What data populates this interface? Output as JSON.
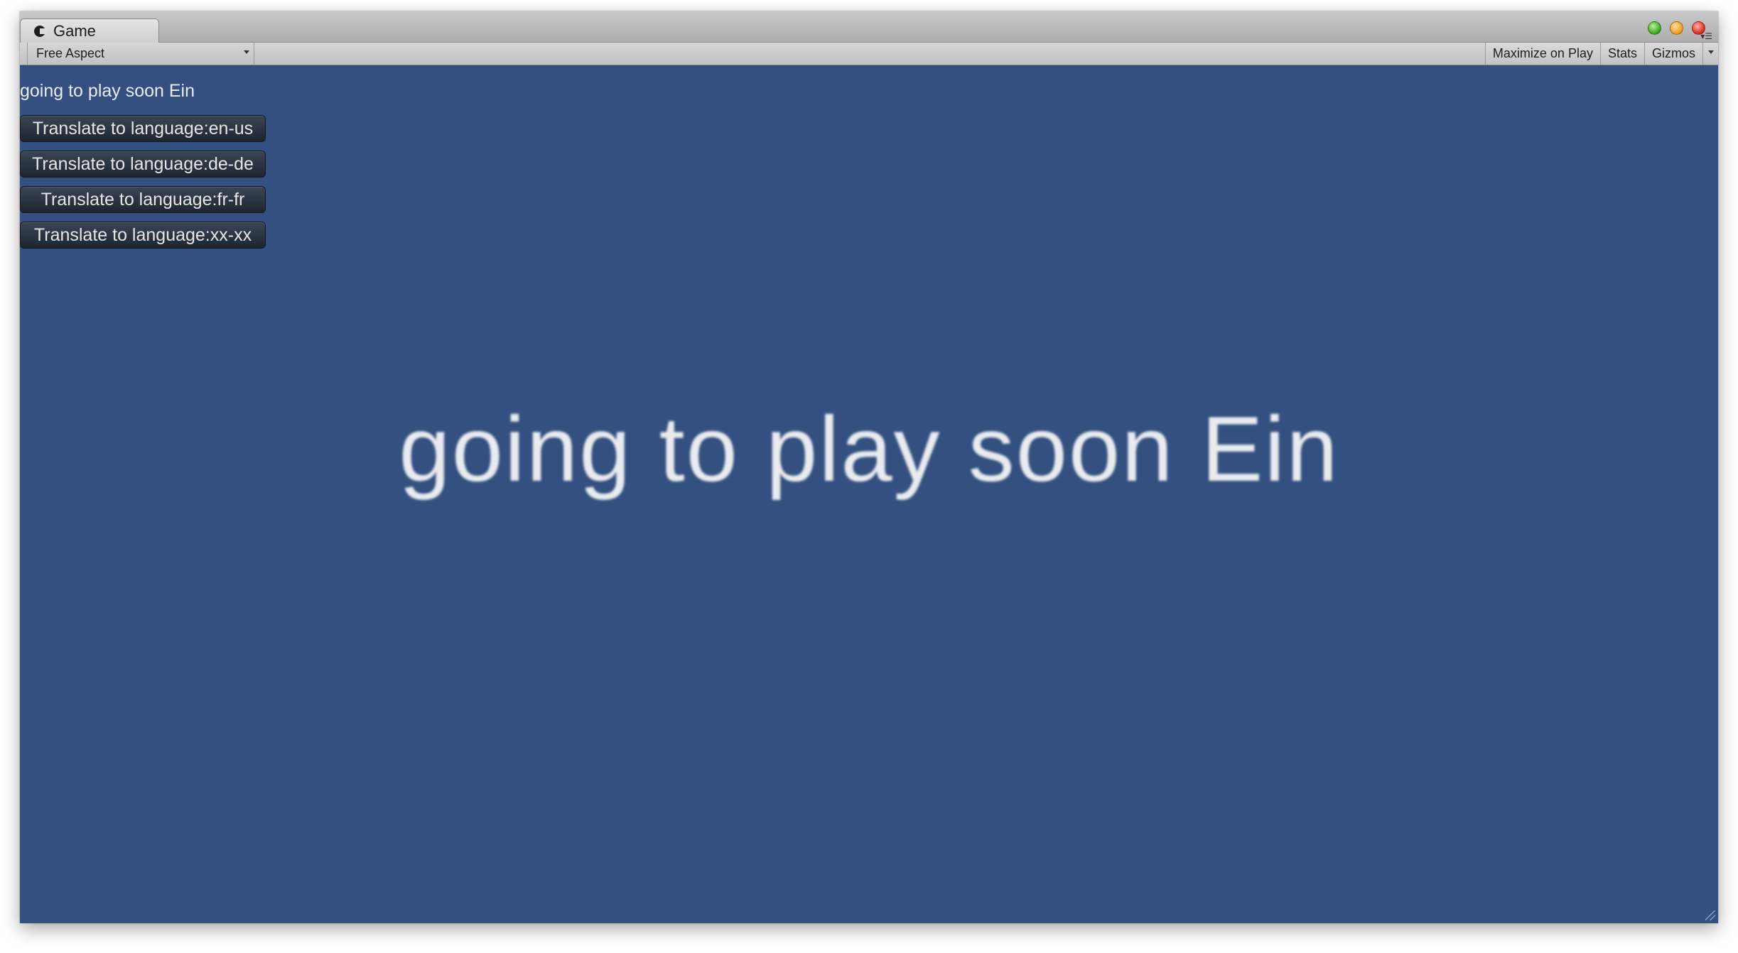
{
  "window": {
    "tab_label": "Game",
    "panel_menu_glyph": "▾☰"
  },
  "toolbar": {
    "aspect_label": "Free Aspect",
    "maximize_label": "Maximize on Play",
    "stats_label": "Stats",
    "gizmos_label": "Gizmos"
  },
  "game": {
    "status_text": "going to play soon Ein",
    "buttons": [
      {
        "label": "Translate to language:en-us"
      },
      {
        "label": "Translate to language:de-de"
      },
      {
        "label": "Translate to language:fr-fr"
      },
      {
        "label": "Translate to language:xx-xx"
      }
    ],
    "big_text": "going to play soon Ein"
  },
  "colors": {
    "game_background": "#335080",
    "button_background": "#252d38",
    "text_light": "#e8ecf2"
  },
  "icons": [
    "unity-icon",
    "maximize-light-icon",
    "minimize-light-icon",
    "close-light-icon",
    "dropdown-caret-icon",
    "panel-menu-icon",
    "resize-grip-icon"
  ]
}
